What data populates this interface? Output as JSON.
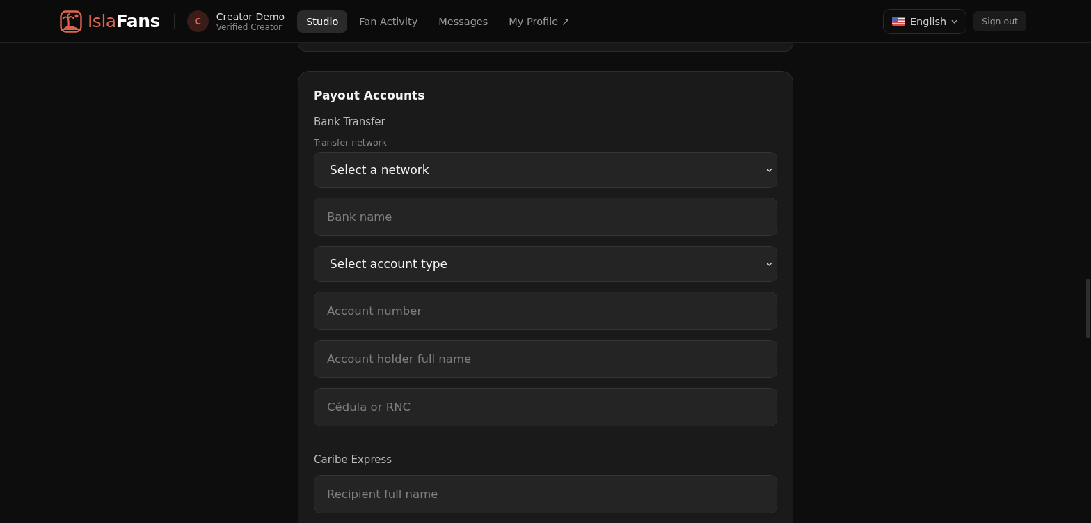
{
  "header": {
    "brand": {
      "part_1": "Isla",
      "part_2": "Fans"
    },
    "user": {
      "initial": "C",
      "name": "Creator Demo",
      "role": "Verified Creator"
    },
    "nav": [
      {
        "label": "Studio",
        "selected": true
      },
      {
        "label": "Fan Activity",
        "selected": false
      },
      {
        "label": "Messages",
        "selected": false
      },
      {
        "label": "My Profile ↗",
        "selected": false
      }
    ],
    "language": "English",
    "sign_out": "Sign out"
  },
  "card": {
    "title": "Payout Accounts",
    "sections": [
      {
        "title": "Bank Transfer",
        "fields": [
          {
            "kind": "select",
            "label": "Transfer network",
            "text": "Select a network"
          },
          {
            "kind": "input",
            "placeholder": "Bank name"
          },
          {
            "kind": "select",
            "text": "Select account type"
          },
          {
            "kind": "input",
            "placeholder": "Account number"
          },
          {
            "kind": "input",
            "placeholder": "Account holder full name"
          },
          {
            "kind": "input",
            "placeholder": "Cédula or RNC"
          }
        ]
      },
      {
        "title": "Caribe Express",
        "fields": [
          {
            "kind": "input",
            "placeholder": "Recipient full name"
          }
        ]
      }
    ]
  }
}
